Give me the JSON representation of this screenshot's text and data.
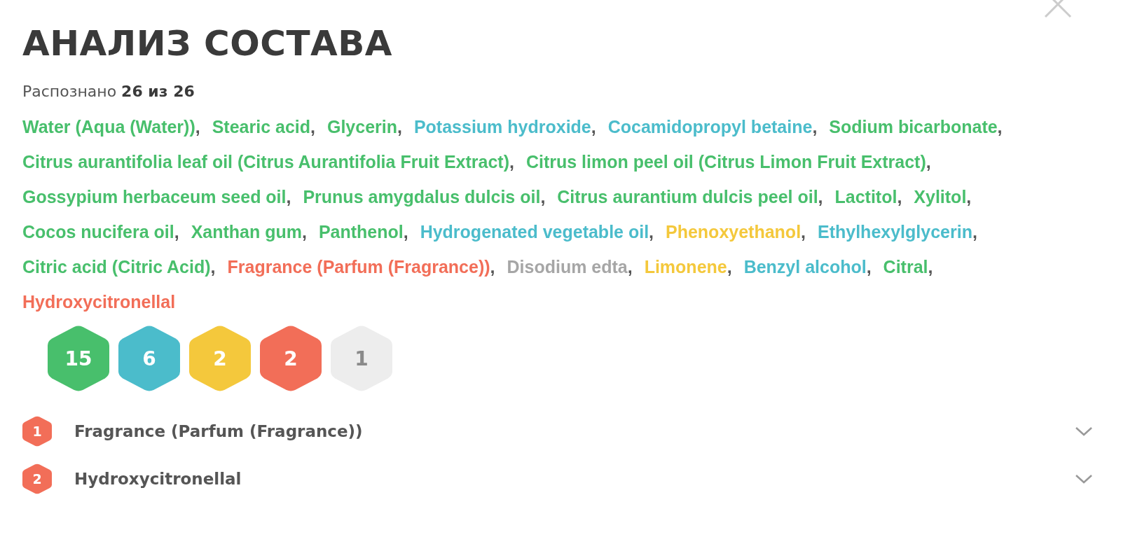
{
  "title": "АНАЛИЗ СОСТАВА",
  "recognized": "Распознано **26 из 26**",
  "separator": ",",
  "ingredients": [
    {
      "name": "Water (Aqua (Water))",
      "color": "#48bf6c"
    },
    {
      "name": "Stearic acid",
      "color": "#48bf6c"
    },
    {
      "name": "Glycerin",
      "color": "#48bf6c"
    },
    {
      "name": "Potassium hydroxide",
      "color": "#4bbccb"
    },
    {
      "name": "Cocamidopropyl betaine",
      "color": "#4bbccb"
    },
    {
      "name": "Sodium bicarbonate",
      "color": "#48bf6c"
    },
    {
      "name": "Citrus aurantifolia leaf oil (Citrus Aurantifolia Fruit Extract)",
      "color": "#48bf6c"
    },
    {
      "name": "Citrus limon peel oil (Citrus Limon Fruit Extract)",
      "color": "#48bf6c"
    },
    {
      "name": "Gossypium herbaceum seed oil",
      "color": "#48bf6c"
    },
    {
      "name": "Prunus amygdalus dulcis oil",
      "color": "#48bf6c"
    },
    {
      "name": "Citrus aurantium dulcis peel oil",
      "color": "#48bf6c"
    },
    {
      "name": "Lactitol",
      "color": "#48bf6c"
    },
    {
      "name": "Xylitol",
      "color": "#48bf6c"
    },
    {
      "name": "Cocos nucifera oil",
      "color": "#48bf6c"
    },
    {
      "name": "Xanthan gum",
      "color": "#48bf6c"
    },
    {
      "name": "Panthenol",
      "color": "#48bf6c"
    },
    {
      "name": "Hydrogenated vegetable oil",
      "color": "#4bbccb"
    },
    {
      "name": "Phenoxyethanol",
      "color": "#f4c83c"
    },
    {
      "name": "Ethylhexylglycerin",
      "color": "#4bbccb"
    },
    {
      "name": "Citric acid (Citric Acid)",
      "color": "#48bf6c"
    },
    {
      "name": "Fragrance (Parfum (Fragrance))",
      "color": "#f26e58"
    },
    {
      "name": "Disodium edta",
      "color": "#a6a6a6"
    },
    {
      "name": "Limonene",
      "color": "#f4c83c"
    },
    {
      "name": "Benzyl alcohol",
      "color": "#4bbccb"
    },
    {
      "name": "Citral",
      "color": "#48bf6c"
    },
    {
      "name": "Hydroxycitronellal",
      "color": "#f26e58"
    }
  ],
  "counts": [
    {
      "value": "15",
      "color": "#48bf6c"
    },
    {
      "value": "6",
      "color": "#4bbccb"
    },
    {
      "value": "2",
      "color": "#f4c83c"
    },
    {
      "value": "2",
      "color": "#f26e58"
    },
    {
      "value": "1",
      "color": "#ededed"
    }
  ],
  "warnings": [
    {
      "number": "1",
      "name": "Fragrance (Parfum (Fragrance))",
      "expanded": false
    },
    {
      "number": "2",
      "name": "Hydroxycitronellal",
      "expanded": false
    }
  ]
}
